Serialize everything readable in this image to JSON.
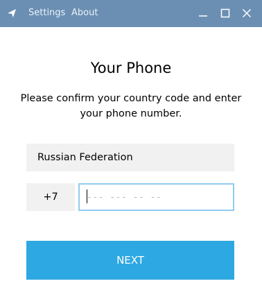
{
  "titlebar": {
    "menu": [
      "Settings",
      "About"
    ],
    "app_icon": "paper-plane-icon",
    "controls": [
      "minimize-icon",
      "maximize-icon",
      "close-icon"
    ],
    "background": "#6b8fb3"
  },
  "main": {
    "title": "Your Phone",
    "description": "Please confirm your country code and enter your phone number.",
    "country": "Russian Federation",
    "country_code": "+7",
    "phone_placeholder": "--- --- -- --",
    "phone_value": "",
    "next_label": "NEXT",
    "accent_color": "#2ea8e2"
  }
}
